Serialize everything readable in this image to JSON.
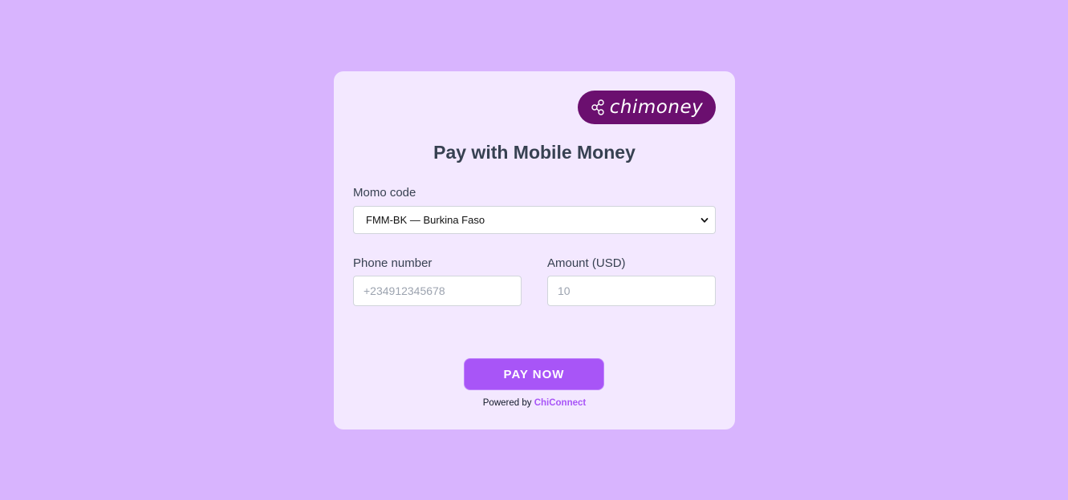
{
  "logo": {
    "text": "chimoney",
    "icon": "chimoney-logo-icon",
    "background": "#6b0f6f"
  },
  "title": "Pay with Mobile Money",
  "momo": {
    "label": "Momo code",
    "selected": "FMM-BK — Burkina Faso"
  },
  "phone": {
    "label": "Phone number",
    "placeholder": "+234912345678"
  },
  "amount": {
    "label": "Amount (USD)",
    "placeholder": "10"
  },
  "button": {
    "label": "PAY NOW"
  },
  "footer": {
    "prefix": "Powered by",
    "link": "ChiConnect"
  },
  "colors": {
    "page_background": "#d8b4fe",
    "card_background": "#f3e8ff",
    "accent": "#a855f7"
  }
}
